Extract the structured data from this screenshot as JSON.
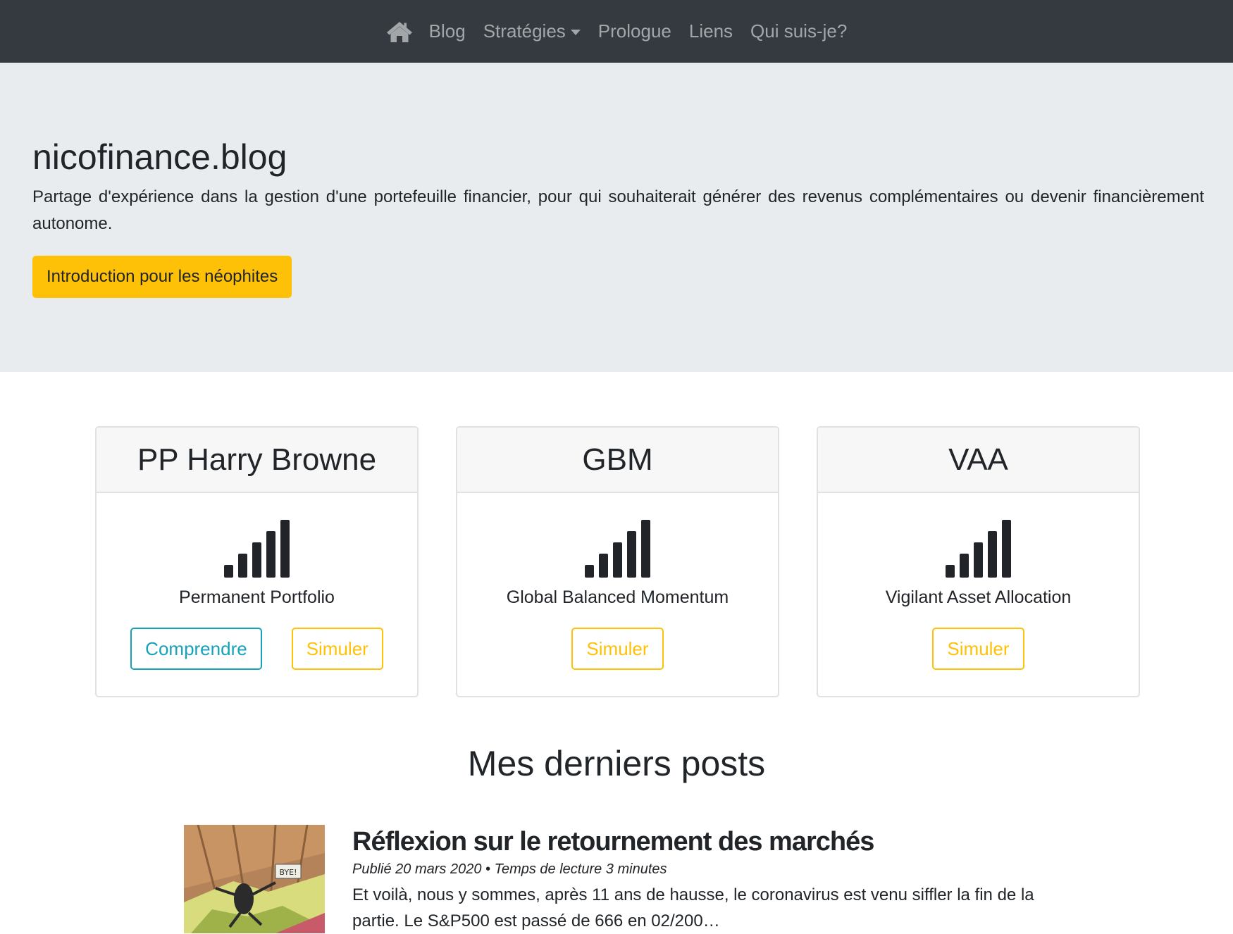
{
  "nav": {
    "home_icon": "home-icon",
    "items": [
      {
        "label": "Blog"
      },
      {
        "label": "Stratégies"
      },
      {
        "label": "Prologue"
      },
      {
        "label": "Liens"
      },
      {
        "label": "Qui suis-je?"
      }
    ]
  },
  "jumbotron": {
    "title": "nicofinance.blog",
    "tagline": "Partage d'expérience dans la gestion d'une portefeuille financier, pour qui souhaiterait générer des revenus complémentaires ou devenir financièrement autonome.",
    "button_label": "Introduction pour les néophites"
  },
  "cards": [
    {
      "title": "PP Harry Browne",
      "icon": "signal-bars-icon",
      "subtitle": "Permanent Portfolio",
      "understand_label": "Comprendre",
      "simulate_label": "Simuler"
    },
    {
      "title": "GBM",
      "icon": "signal-bars-icon",
      "subtitle": "Global Balanced Momentum",
      "simulate_label": "Simuler"
    },
    {
      "title": "VAA",
      "icon": "signal-bars-icon",
      "subtitle": "Vigilant Asset Allocation",
      "simulate_label": "Simuler"
    }
  ],
  "posts": {
    "heading": "Mes derniers posts",
    "items": [
      {
        "title": "Réflexion sur le retournement des marchés",
        "meta": "Publié 20 mars 2020 • Temps de lecture 3 minutes",
        "excerpt": "Et voilà, nous y sommes, après 11 ans de hausse, le coronavirus est venu siffler la fin de la partie. Le S&P500 est passé de 666 en 02/200…",
        "thumb_sign": "BYE!"
      }
    ]
  },
  "colors": {
    "navbar_bg": "#343a40",
    "jumbotron_bg": "#e9ecef",
    "warning": "#ffc107",
    "info": "#17a2b8"
  }
}
